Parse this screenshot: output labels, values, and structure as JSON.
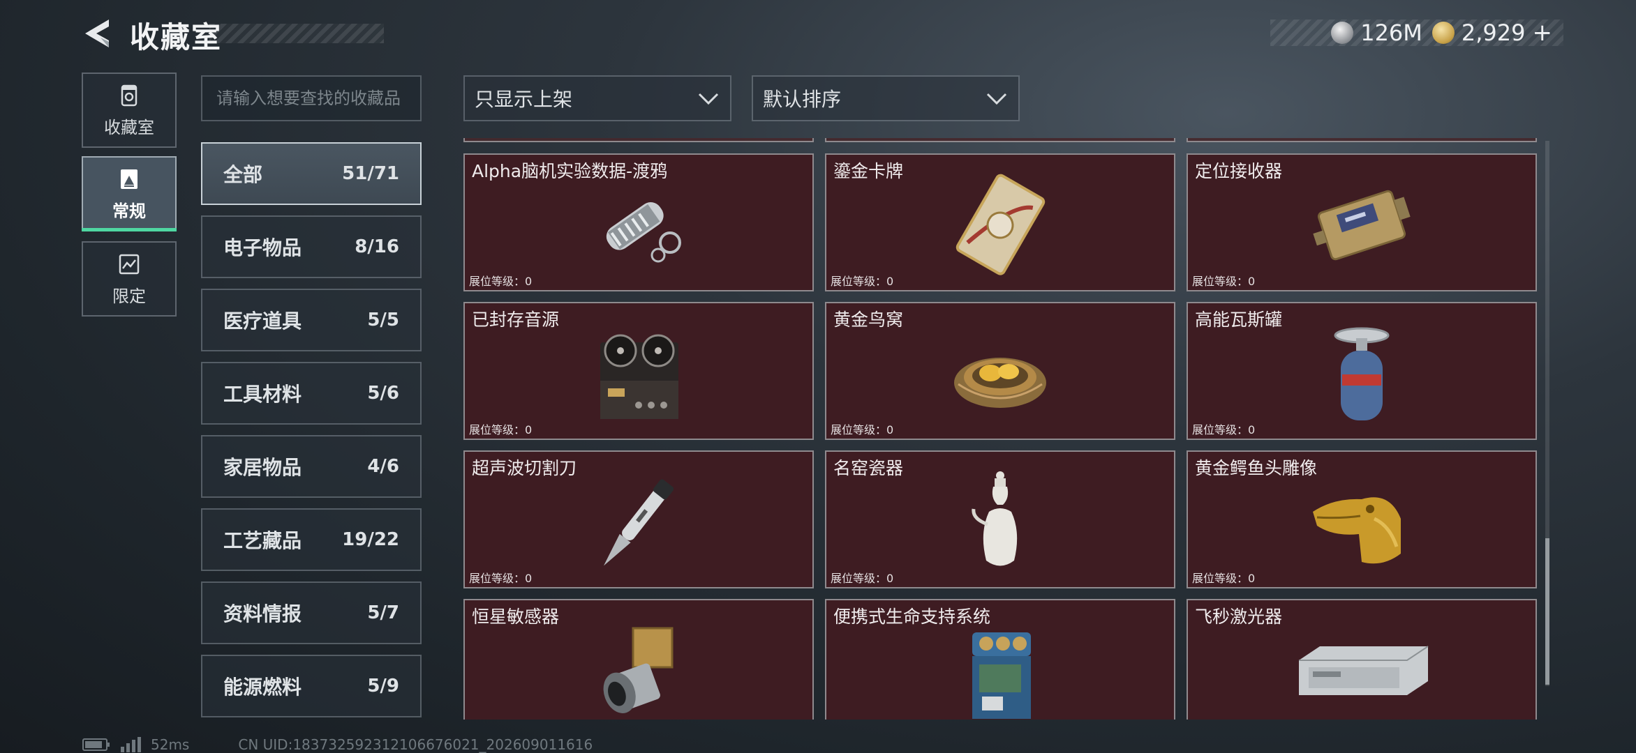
{
  "header": {
    "title": "收藏室",
    "currency_silver": "126M",
    "currency_gold": "2,929",
    "plus": "+"
  },
  "mode_tabs": [
    {
      "label": "收藏室",
      "icon": "trophy-box-icon"
    },
    {
      "label": "常规",
      "icon": "collection-icon"
    },
    {
      "label": "限定",
      "icon": "limited-icon"
    }
  ],
  "search": {
    "placeholder": "请输入想要查找的收藏品"
  },
  "filters": {
    "show_filter": "只显示上架",
    "sort": "默认排序"
  },
  "categories": [
    {
      "name": "全部",
      "count": "51/71"
    },
    {
      "name": "电子物品",
      "count": "8/16"
    },
    {
      "name": "医疗道具",
      "count": "5/5"
    },
    {
      "name": "工具材料",
      "count": "5/6"
    },
    {
      "name": "家居物品",
      "count": "4/6"
    },
    {
      "name": "工艺藏品",
      "count": "19/22"
    },
    {
      "name": "资料情报",
      "count": "5/7"
    },
    {
      "name": "能源燃料",
      "count": "5/9"
    }
  ],
  "items": [
    {
      "name": "Alpha脑机实验数据-渡鸦",
      "level": "展位等级：0",
      "icon": "data-canister-icon"
    },
    {
      "name": "鎏金卡牌",
      "level": "展位等级：0",
      "icon": "gilded-card-icon"
    },
    {
      "name": "定位接收器",
      "level": "展位等级：0",
      "icon": "locator-receiver-icon"
    },
    {
      "name": "已封存音源",
      "level": "展位等级：0",
      "icon": "reel-recorder-icon"
    },
    {
      "name": "黄金鸟窝",
      "level": "展位等级：0",
      "icon": "golden-nest-icon"
    },
    {
      "name": "高能瓦斯罐",
      "level": "展位等级：0",
      "icon": "gas-canister-icon"
    },
    {
      "name": "超声波切割刀",
      "level": "展位等级：0",
      "icon": "ultrasonic-knife-icon"
    },
    {
      "name": "名窑瓷器",
      "level": "展位等级：0",
      "icon": "porcelain-vase-icon"
    },
    {
      "name": "黄金鳄鱼头雕像",
      "level": "展位等级：0",
      "icon": "gold-crocodile-icon"
    },
    {
      "name": "恒星敏感器",
      "level": "",
      "icon": "star-sensor-icon"
    },
    {
      "name": "便携式生命支持系统",
      "level": "",
      "icon": "life-support-icon"
    },
    {
      "name": "飞秒激光器",
      "level": "",
      "icon": "femtosecond-laser-icon"
    }
  ],
  "footer": {
    "ping": "52ms",
    "uid": "CN UID:18373259231210667602​1_202609011616"
  }
}
